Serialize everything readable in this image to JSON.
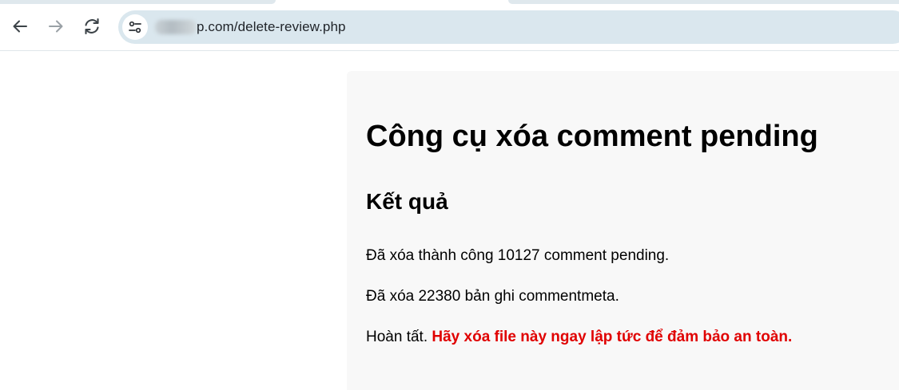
{
  "browser": {
    "url_suffix": "p.com/delete-review.php",
    "icons": {
      "back": "arrow-left-icon",
      "forward": "arrow-right-icon",
      "reload": "reload-icon",
      "site_info": "tune-settings-icon"
    }
  },
  "page": {
    "title": "Công cụ xóa comment pending",
    "result_heading": "Kết quả",
    "lines": [
      "Đã xóa thành công 10127 comment pending.",
      "Đã xóa 22380 bản ghi commentmeta."
    ],
    "done_label": "Hoàn tất.",
    "warning": "Hãy xóa file này ngay lập tức để đảm bảo an toàn."
  },
  "colors": {
    "warning": "#e00000",
    "omnibox": "#dae7ee",
    "panel": "#f8f8f8"
  }
}
